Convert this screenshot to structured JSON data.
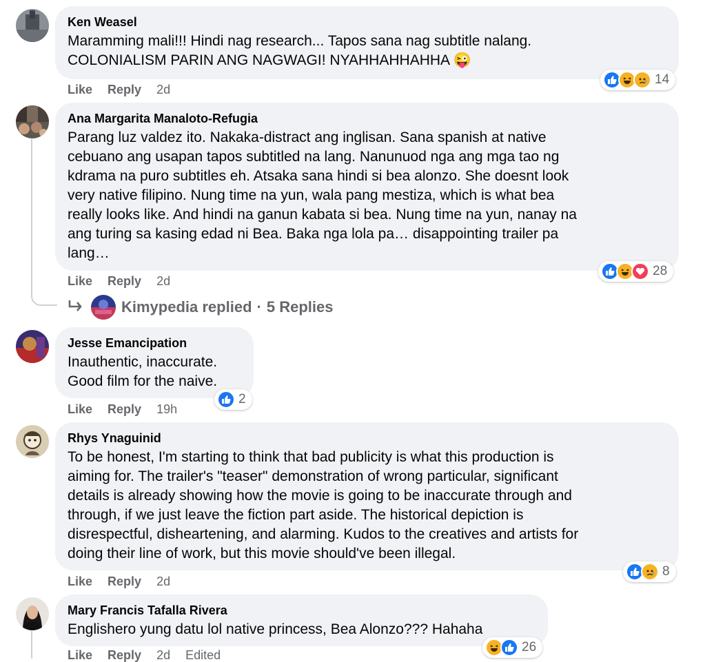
{
  "comments": [
    {
      "author": "Ken Weasel",
      "text": "Maramming mali!!! Hindi nag research... Tapos sana nag subtitle nalang.\nCOLONIALISM PARIN ANG NAGWAGI! NYAHHAHHAHHA 😜",
      "like": "Like",
      "reply": "Reply",
      "time": "2d",
      "reactions": [
        "like-icon",
        "haha-icon",
        "sad-icon"
      ],
      "reaction_count": "14"
    },
    {
      "author": "Ana Margarita Manaloto-Refugia",
      "text": "Parang luz valdez ito. Nakaka-distract ang inglisan. Sana spanish at native\ncebuano ang usapan tapos subtitled na lang. Nanunuod nga ang mga tao ng\nkdrama na puro subtitles eh. Atsaka sana hindi si bea alonzo. She doesnt look\nvery native filipino. Nung time na yun, wala pang mestiza, which is what bea\nreally looks like. And hindi na ganun kabata si bea. Nung time na yun, nanay na\nang turing sa kasing edad ni Bea. Baka nga lola pa… disappointing trailer pa\nlang…",
      "like": "Like",
      "reply": "Reply",
      "time": "2d",
      "reactions": [
        "like-icon",
        "haha-icon",
        "love-icon"
      ],
      "reaction_count": "28",
      "replies_summary": {
        "name": "Kimypedia replied",
        "separator": "·",
        "count": "5 Replies"
      }
    },
    {
      "author": "Jesse Emancipation",
      "text": "Inauthentic, inaccurate.\nGood film for the naive.",
      "like": "Like",
      "reply": "Reply",
      "time": "19h",
      "reactions": [
        "like-icon"
      ],
      "reaction_count": "2"
    },
    {
      "author": "Rhys Ynaguinid",
      "text": "To be honest, I'm starting to think that bad publicity is what this production is\naiming for. The trailer's \"teaser\" demonstration of wrong particular, significant\ndetails is already showing how the movie is going to be inaccurate through and\nthrough, if we just leave the fiction part aside. The historical depiction is\ndisrespectful, disheartening, and alarming. Kudos to the creatives and artists for\ndoing their line of work, but this movie should've been illegal.",
      "like": "Like",
      "reply": "Reply",
      "time": "2d",
      "reactions": [
        "like-icon",
        "sad-icon"
      ],
      "reaction_count": "8"
    },
    {
      "author": "Mary Francis Tafalla Rivera",
      "text": "Englishero yung datu lol native princess, Bea Alonzo??? Hahaha",
      "like": "Like",
      "reply": "Reply",
      "time": "2d",
      "edited": "Edited",
      "reactions": [
        "haha-icon",
        "like-icon"
      ],
      "reaction_count": "26"
    }
  ],
  "colors": {
    "bubble": "#f0f2f5",
    "meta": "#65676b",
    "like": "#1877f2",
    "haha": "#f7b125",
    "love": "#f33e58"
  }
}
